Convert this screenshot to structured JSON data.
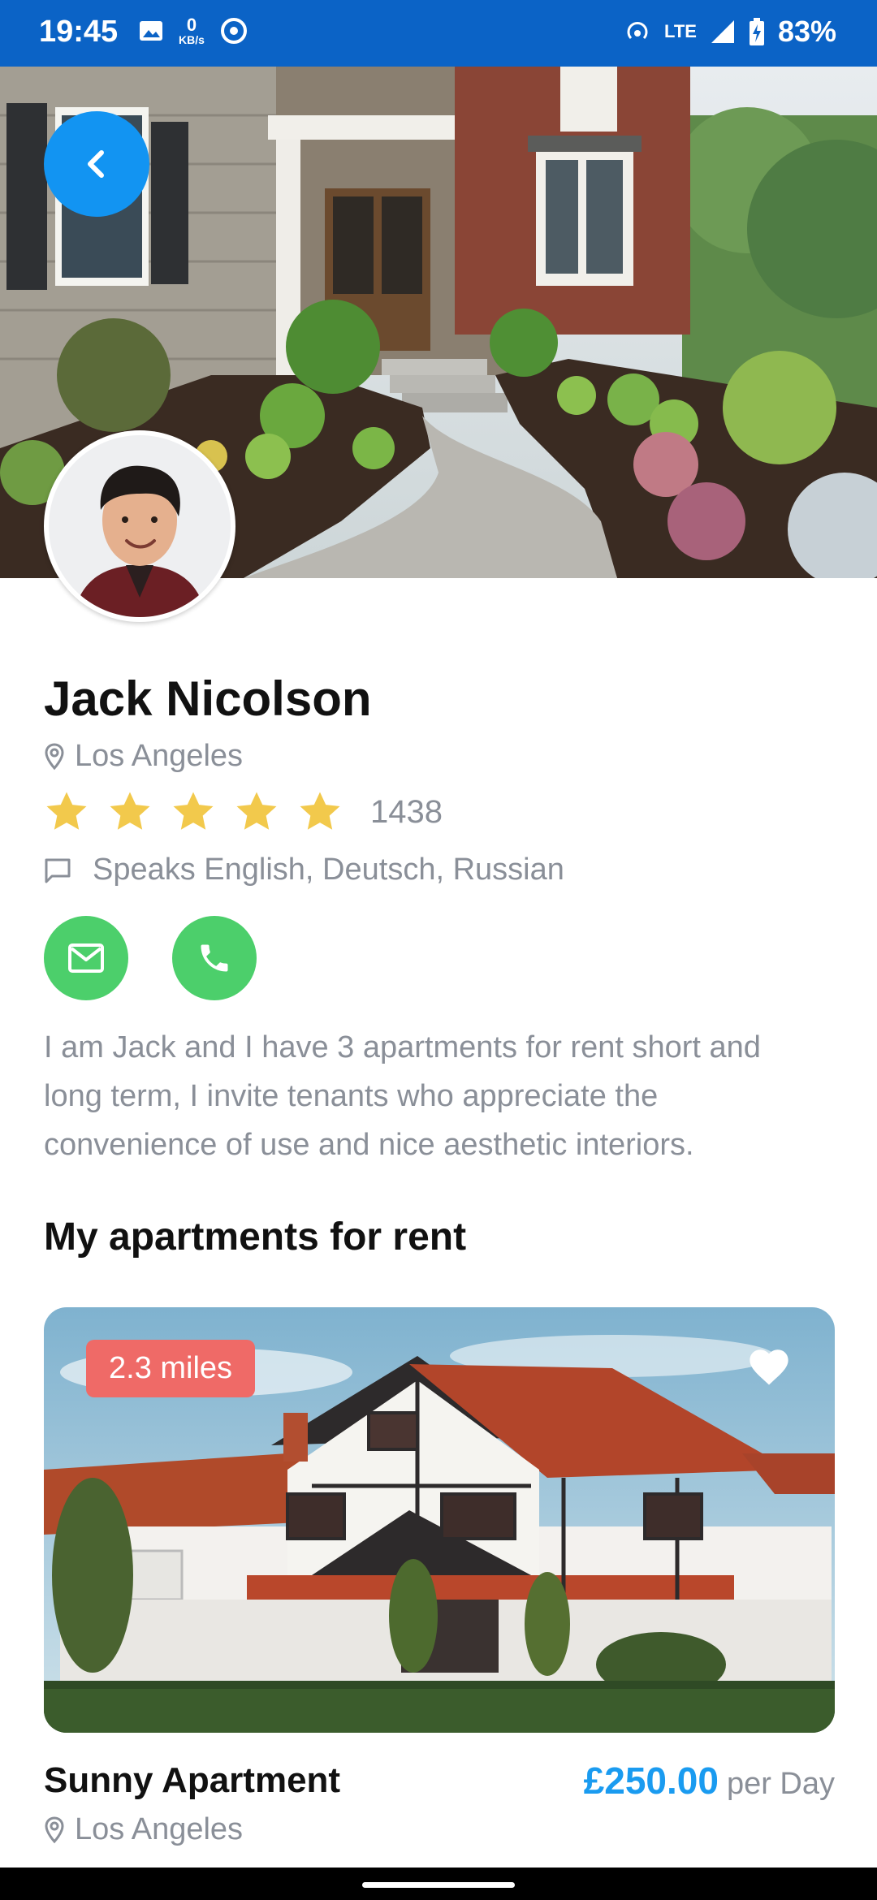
{
  "status": {
    "time": "19:45",
    "kbs_top": "0",
    "kbs_bottom": "KB/s",
    "network": "LTE",
    "battery": "83%"
  },
  "profile": {
    "name": "Jack Nicolson",
    "location": "Los Angeles",
    "rating": 5,
    "reviews": "1438",
    "languages": "Speaks English, Deutsch, Russian",
    "bio": "I am Jack and I have 3 apartments for rent short and long term, I invite tenants who appreciate the convenience of use and nice aesthetic interiors."
  },
  "section": {
    "title": "My apartments for rent"
  },
  "apartment": {
    "distance": "2.3 miles",
    "title": "Sunny Apartment",
    "location": "Los Angeles",
    "price": "£250.00",
    "per": "per Day"
  },
  "icons": {
    "back": "chevron-left-icon",
    "mail": "mail-icon",
    "phone": "phone-icon",
    "heart": "heart-icon",
    "pin": "location-pin-icon",
    "chat": "chat-bubble-icon",
    "star": "star-icon"
  },
  "colors": {
    "status_bar": "#0b63c6",
    "accent_blue": "#1294f2",
    "contact_green": "#4ccf6b",
    "badge_red": "#ef6a67",
    "star_yellow": "#f2c94c",
    "muted_text": "#8a8f98"
  }
}
